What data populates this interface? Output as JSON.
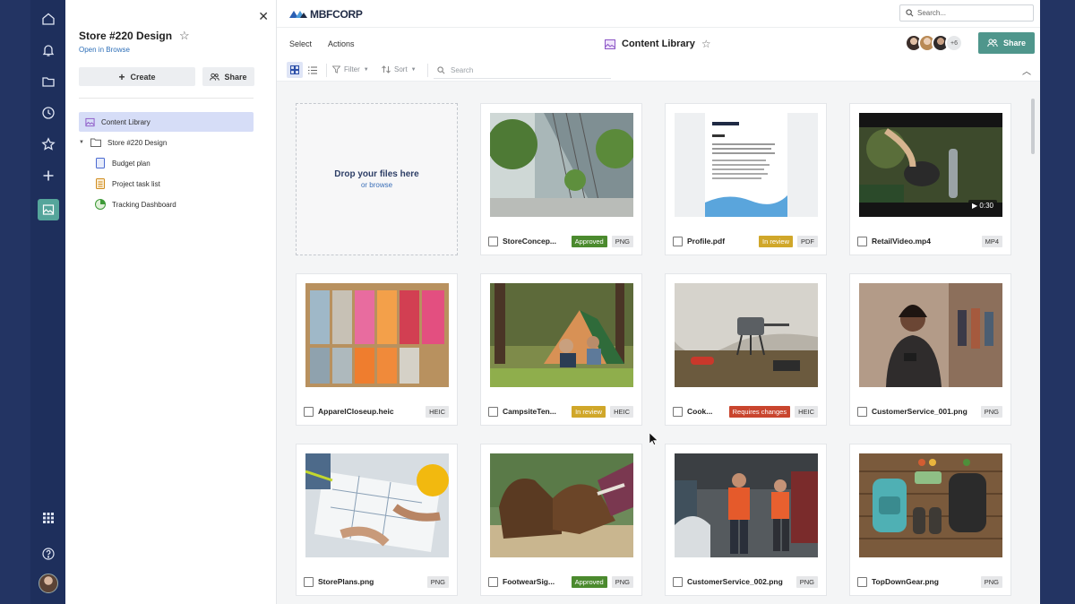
{
  "rail": {
    "items": [
      "home-icon",
      "bell-icon",
      "folder-icon",
      "clock-icon",
      "star-icon",
      "plus-icon",
      "content-library-icon"
    ],
    "bottom": [
      "apps-grid-icon",
      "help-icon",
      "user-avatar"
    ]
  },
  "panel": {
    "title": "Store #220 Design",
    "open_in_browse": "Open in Browse",
    "create_label": "Create",
    "share_label": "Share",
    "tree": [
      {
        "label": "Content Library",
        "icon": "content-library-icon",
        "level": 0,
        "selected": true
      },
      {
        "label": "Store #220 Design",
        "icon": "folder-icon",
        "level": 1,
        "selected": false
      },
      {
        "label": "Budget plan",
        "icon": "document-icon",
        "level": 2,
        "selected": false
      },
      {
        "label": "Project task list",
        "icon": "task-list-icon",
        "level": 2,
        "selected": false
      },
      {
        "label": "Tracking Dashboard",
        "icon": "dashboard-icon",
        "level": 2,
        "selected": false
      }
    ]
  },
  "topbar": {
    "logo": "MBFCORP",
    "search_placeholder": "Search..."
  },
  "toolbar": {
    "select": "Select",
    "actions": "Actions",
    "page_title": "Content Library",
    "more_collaborators": "+6",
    "share": "Share"
  },
  "filterbar": {
    "filter": "Filter",
    "sort": "Sort",
    "search_placeholder": "Search"
  },
  "dropzone": {
    "main": "Drop your files here",
    "sub": "or browse"
  },
  "colors": {
    "approved": "#4b8a2e",
    "in_review": "#d0a72a",
    "requires_changes": "#c9452e",
    "accent": "#4f968c"
  },
  "files": [
    {
      "name": "StoreConcep...",
      "status": "Approved",
      "type": "PNG",
      "thumb": "architecture"
    },
    {
      "name": "Profile.pdf",
      "status": "In review",
      "type": "PDF",
      "thumb": "document"
    },
    {
      "name": "RetailVideo.mp4",
      "status": "",
      "type": "MP4",
      "thumb": "video",
      "duration": "0:30"
    },
    {
      "name": "ApparelCloseup.heic",
      "status": "",
      "type": "HEIC",
      "thumb": "apparel"
    },
    {
      "name": "CampsiteTen...",
      "status": "In review",
      "type": "HEIC",
      "thumb": "campsite"
    },
    {
      "name": "Cook...",
      "status": "Requires changes",
      "type": "HEIC",
      "thumb": "cook"
    },
    {
      "name": "CustomerService_001.png",
      "status": "",
      "type": "PNG",
      "thumb": "customer1"
    },
    {
      "name": "StorePlans.png",
      "status": "",
      "type": "PNG",
      "thumb": "plans"
    },
    {
      "name": "FootwearSig...",
      "status": "Approved",
      "type": "PNG",
      "thumb": "footwear"
    },
    {
      "name": "CustomerService_002.png",
      "status": "",
      "type": "PNG",
      "thumb": "customer2"
    },
    {
      "name": "TopDownGear.png",
      "status": "",
      "type": "PNG",
      "thumb": "gear"
    }
  ]
}
